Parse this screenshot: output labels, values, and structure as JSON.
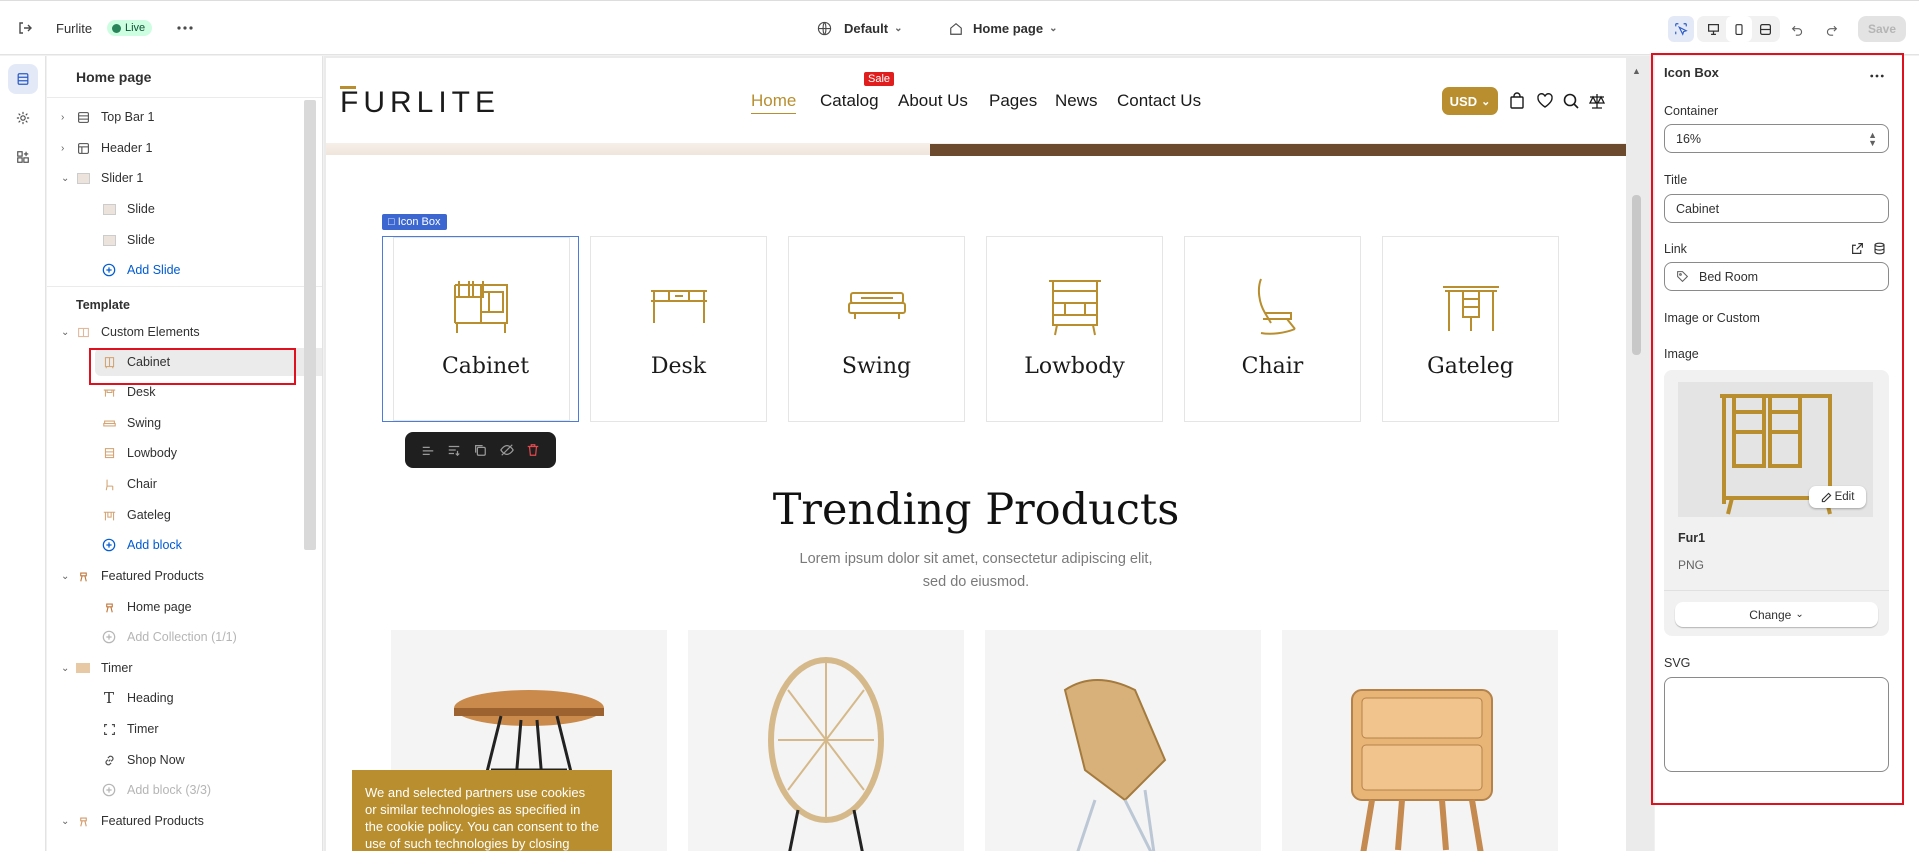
{
  "topbar": {
    "store_name": "Furlite",
    "status": "Live",
    "theme": "Default",
    "page": "Home page",
    "save_label": "Save"
  },
  "tree": {
    "title": "Home page",
    "items": [
      {
        "label": "Top Bar 1"
      },
      {
        "label": "Header 1"
      },
      {
        "label": "Slider 1"
      },
      {
        "label": "Slide"
      },
      {
        "label": "Slide"
      },
      {
        "label": "Add Slide"
      }
    ],
    "template_label": "Template",
    "template_items": [
      {
        "label": "Custom Elements"
      },
      {
        "label": "Cabinet"
      },
      {
        "label": "Desk"
      },
      {
        "label": "Swing"
      },
      {
        "label": "Lowbody"
      },
      {
        "label": "Chair"
      },
      {
        "label": "Gateleg"
      },
      {
        "label": "Add block"
      },
      {
        "label": "Featured Products"
      },
      {
        "label": "Home page"
      },
      {
        "label": "Add Collection (1/1)"
      },
      {
        "label": "Timer"
      },
      {
        "label": "Heading"
      },
      {
        "label": "Timer"
      },
      {
        "label": "Shop Now"
      },
      {
        "label": "Add block (3/3)"
      },
      {
        "label": "Featured Products"
      }
    ]
  },
  "preview": {
    "logo": "FURLITE",
    "nav": [
      "Home",
      "Catalog",
      "About Us",
      "Pages",
      "News",
      "Contact Us"
    ],
    "sale_badge": "Sale",
    "currency": "USD",
    "selected_tag": "Icon Box",
    "icon_boxes": [
      "Cabinet",
      "Desk",
      "Swing",
      "Lowbody",
      "Chair",
      "Gateleg"
    ],
    "trending_title": "Trending Products",
    "trending_sub_1": "Lorem ipsum dolor sit amet, consectetur adipiscing elit,",
    "trending_sub_2": "sed do eiusmod.",
    "cookie_text": "We and selected partners use cookies or similar technologies as specified in the cookie policy. You can consent to the use of such technologies by closing"
  },
  "panel": {
    "title": "Icon Box",
    "container_label": "Container",
    "container_value": "16%",
    "title_label": "Title",
    "title_value": "Cabinet",
    "link_label": "Link",
    "link_value": "Bed Room",
    "image_or_custom": "Image or Custom",
    "image_label": "Image",
    "edit_label": "Edit",
    "file_name": "Fur1",
    "file_type": "PNG",
    "change_label": "Change",
    "svg_label": "SVG"
  },
  "colors": {
    "accent": "#b88e2f",
    "highlight": "#e0111f",
    "selection": "#3c67d0"
  }
}
